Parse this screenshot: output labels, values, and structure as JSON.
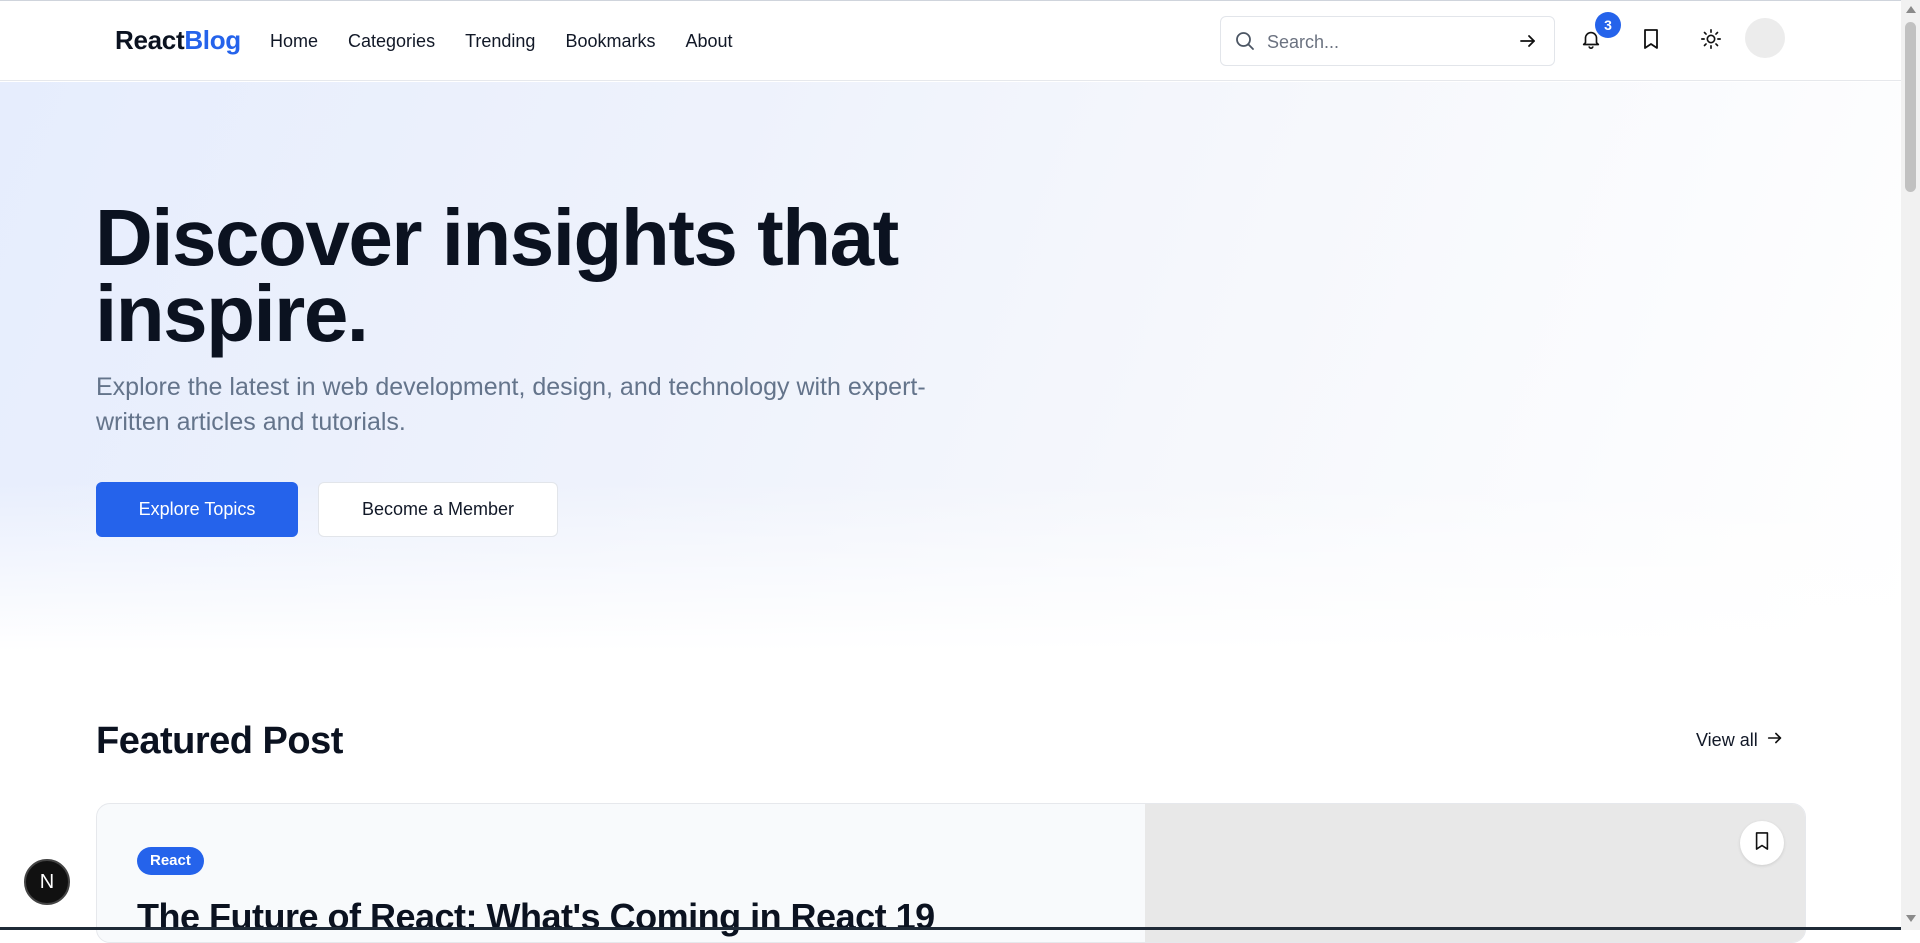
{
  "nav": {
    "logo_main": "React",
    "logo_accent": "Blog",
    "links": [
      "Home",
      "Categories",
      "Trending",
      "Bookmarks",
      "About"
    ],
    "search_placeholder": "Search...",
    "notifications_count": "3"
  },
  "hero": {
    "title": "Discover insights that inspire.",
    "subtitle": "Explore the latest in web development, design, and technology with expert-written articles and tutorials.",
    "primary_button": "Explore Topics",
    "secondary_button": "Become a Member"
  },
  "featured": {
    "section_title": "Featured Post",
    "view_all": "View all",
    "tag": "React",
    "post_title": "The Future of React: What's Coming in React 19"
  },
  "floating": {
    "badge_letter": "N"
  },
  "colors": {
    "accent": "#2563eb",
    "text": "#0b1220",
    "muted": "#64748b"
  }
}
